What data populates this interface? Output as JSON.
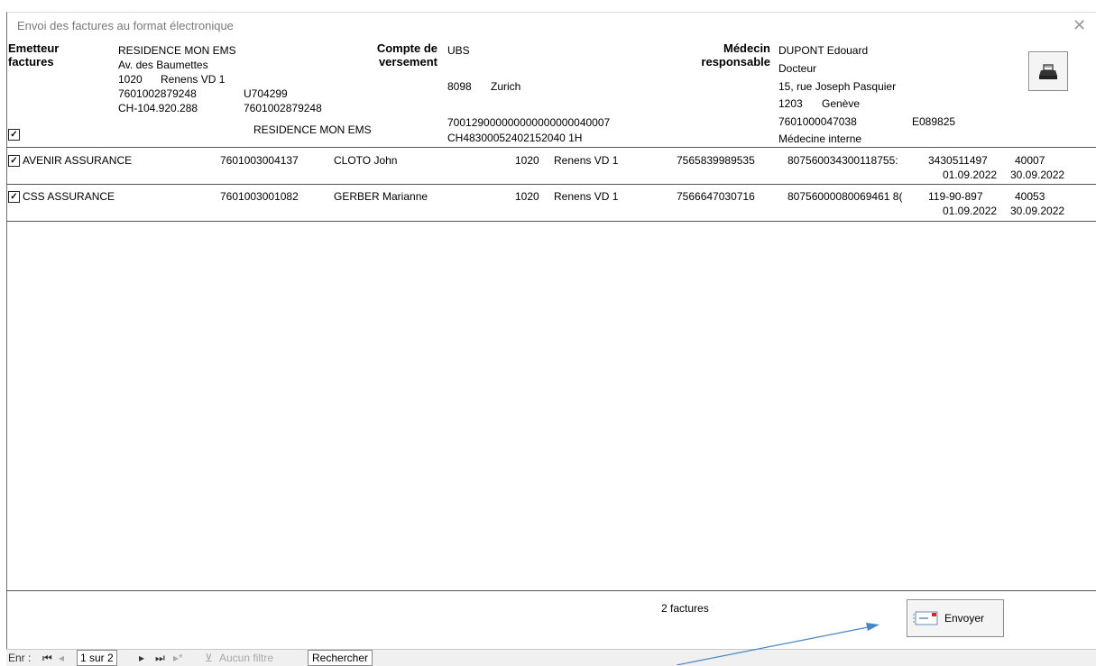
{
  "window": {
    "title": "Envoi des factures au format électronique"
  },
  "header": {
    "emitter": {
      "label_line1": "Emetteur",
      "label_line2": "factures",
      "name": "RESIDENCE MON EMS",
      "street": "Av. des Baumettes",
      "zip": "1020",
      "city": "Renens VD 1",
      "gln": "7601002879248",
      "rcc": "U704299",
      "ide": "CH-104.920.288",
      "gln2": "7601002879248",
      "name2": "RESIDENCE MON EMS"
    },
    "account": {
      "label_line1": "Compte de",
      "label_line2": "versement",
      "bank": "UBS",
      "zip": "8098",
      "city": "Zurich",
      "account_no": "700129000000000000000040007",
      "iban": "CH48300052402152040 1H"
    },
    "doctor": {
      "label_line1": "Médecin",
      "label_line2": "responsable",
      "name": "DUPONT Edouard",
      "title": "Docteur",
      "street": "15, rue Joseph Pasquier",
      "zip": "1203",
      "city": "Genève",
      "gln": "7601000047038",
      "rcc": "E089825",
      "specialty": "Médecine interne"
    },
    "print_icon": "printer-icon"
  },
  "rows": [
    {
      "insurer": "AVENIR ASSURANCE",
      "insurer_gln": "7601003004137",
      "patient": "CLOTO John",
      "zip": "1020",
      "city": "Renens VD 1",
      "avs": "7565839989535",
      "card": "807560034300118755:",
      "policy": "3430511497",
      "ref": "40007",
      "date_from": "01.09.2022",
      "date_to": "30.09.2022"
    },
    {
      "insurer": "CSS ASSURANCE",
      "insurer_gln": "7601003001082",
      "patient": "GERBER Marianne",
      "zip": "1020",
      "city": "Renens VD 1",
      "avs": "7566647030716",
      "card": "80756000080069461 8(",
      "policy": "119-90-897",
      "ref": "40053",
      "date_from": "01.09.2022",
      "date_to": "30.09.2022"
    }
  ],
  "footer": {
    "count": "2 factures",
    "send_label": "Envoyer",
    "send_icon": "envelope-icon"
  },
  "nav": {
    "record_label": "Enr :",
    "position": "1 sur 2",
    "filter_label": "Aucun filtre",
    "search_label": "Rechercher"
  },
  "colors": {
    "annotation_arrow": "#4a86c5"
  }
}
